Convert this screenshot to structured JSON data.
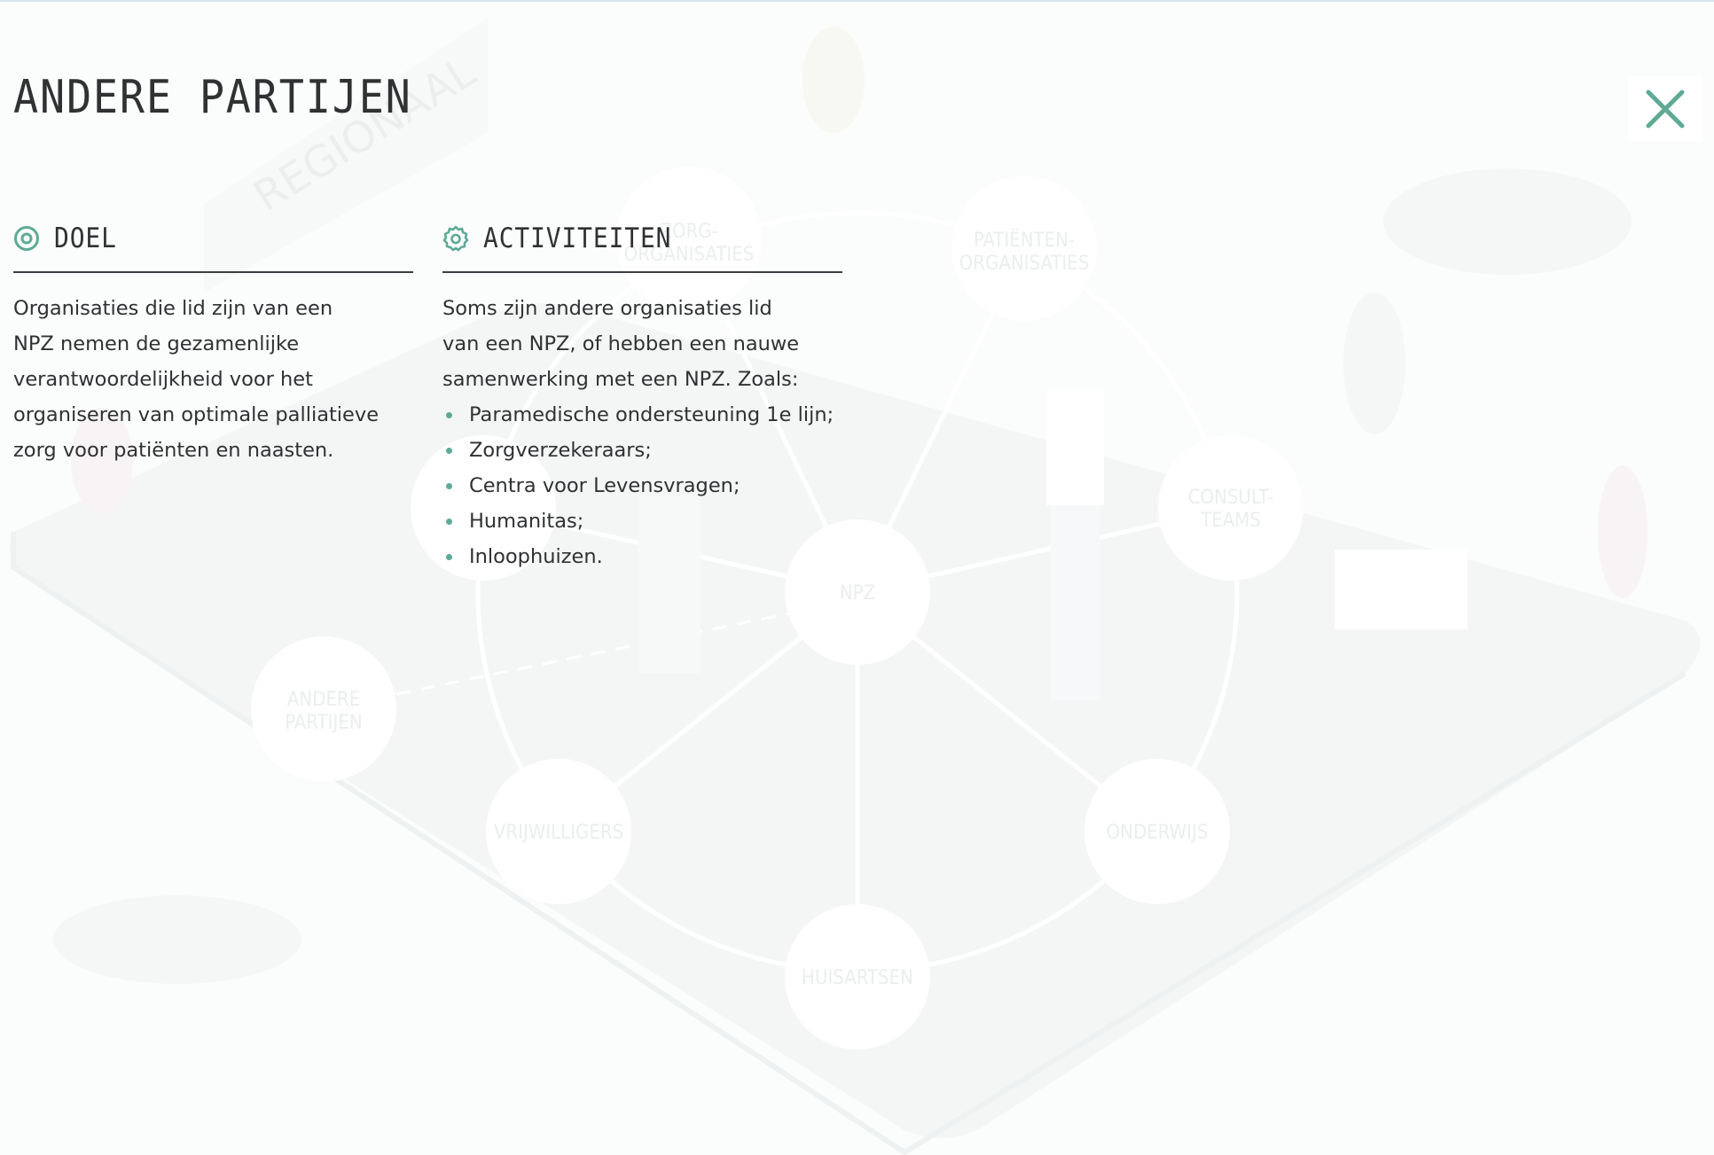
{
  "modal": {
    "title": "ANDERE PARTIJEN",
    "close_icon": "close-icon",
    "accent_color": "#5faa95"
  },
  "doel": {
    "heading": "DOEL",
    "icon": "target-icon",
    "lines": [
      "Organisaties die lid zijn van een",
      "NPZ nemen de gezamenlijke",
      "verantwoordelijkheid voor het",
      "organiseren van optimale palliatieve",
      "zorg voor patiënten en naasten."
    ]
  },
  "activiteiten": {
    "heading": "ACTIVITEITEN",
    "icon": "gear-icon",
    "lines": [
      "Soms zijn andere organisaties lid",
      "van een NPZ, of hebben een nauwe",
      "samenwerking met een NPZ. Zoals:"
    ],
    "items": [
      "Paramedische ondersteuning 1e lijn;",
      "Zorgverzekeraars;",
      "Centra voor Levensvragen;",
      "Humanitas;",
      "Inloophuizen."
    ]
  },
  "background": {
    "region_label": "REGIONAAL",
    "nodes": {
      "zorg": "ZORG-\nORGANISATIES",
      "patient": "PATIËNTEN-\nORGANISATIES",
      "consult": "CONSULT-\nTEAMS",
      "npz": "NPZ",
      "andere": "ANDERE\nPARTIJEN",
      "bottom_left": "VRIJWILLIGERS",
      "bottom_right": "ONDERWIJS",
      "bottom": "HUISARTSEN"
    }
  }
}
